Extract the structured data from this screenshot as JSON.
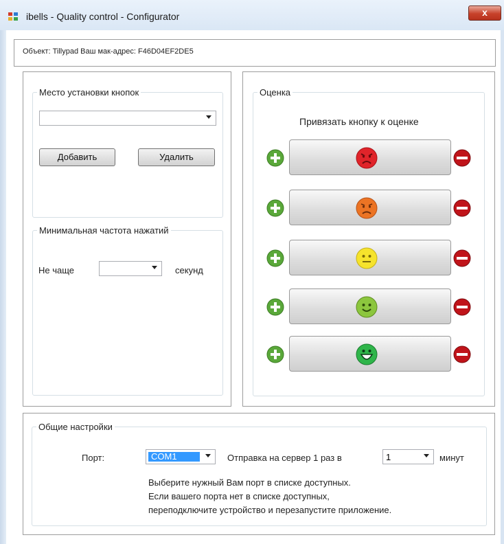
{
  "window": {
    "title": "ibells - Quality control - Configurator",
    "close_glyph": "x"
  },
  "info": {
    "text": "Объект: Tillypad Ваш мак-адрес: F46D04EF2DE5"
  },
  "buttons_location": {
    "legend": "Место установки кнопок",
    "combo_value": "",
    "add_label": "Добавить",
    "delete_label": "Удалить"
  },
  "min_frequency": {
    "legend": "Минимальная частота нажатий",
    "prefix": "Не чаще",
    "combo_value": "",
    "suffix": "секунд"
  },
  "rating": {
    "legend": "Оценка",
    "subtitle": "Привязать кнопку к оценке",
    "levels": [
      {
        "face": "very-angry-face-icon",
        "color": "#e0242a"
      },
      {
        "face": "angry-face-icon",
        "color": "#ec7424"
      },
      {
        "face": "neutral-face-icon",
        "color": "#f6e32c"
      },
      {
        "face": "smile-face-icon",
        "color": "#8cc63e"
      },
      {
        "face": "big-smile-face-icon",
        "color": "#2fb54a"
      }
    ]
  },
  "general": {
    "legend": "Общие настройки",
    "port_label": "Порт:",
    "port_value": "COM1",
    "send_label": "Отправка на сервер 1 раз в",
    "interval_value": "1",
    "interval_unit": "минут",
    "hint_lines": [
      "Выберите нужный Вам порт в списке доступных.",
      "Если вашего порта нет в списке доступных,",
      "переподключите устройство и перезапустите приложение."
    ]
  },
  "colors": {
    "selection": "#3399ff",
    "plus": "#5aa83a",
    "minus": "#c0141a"
  }
}
